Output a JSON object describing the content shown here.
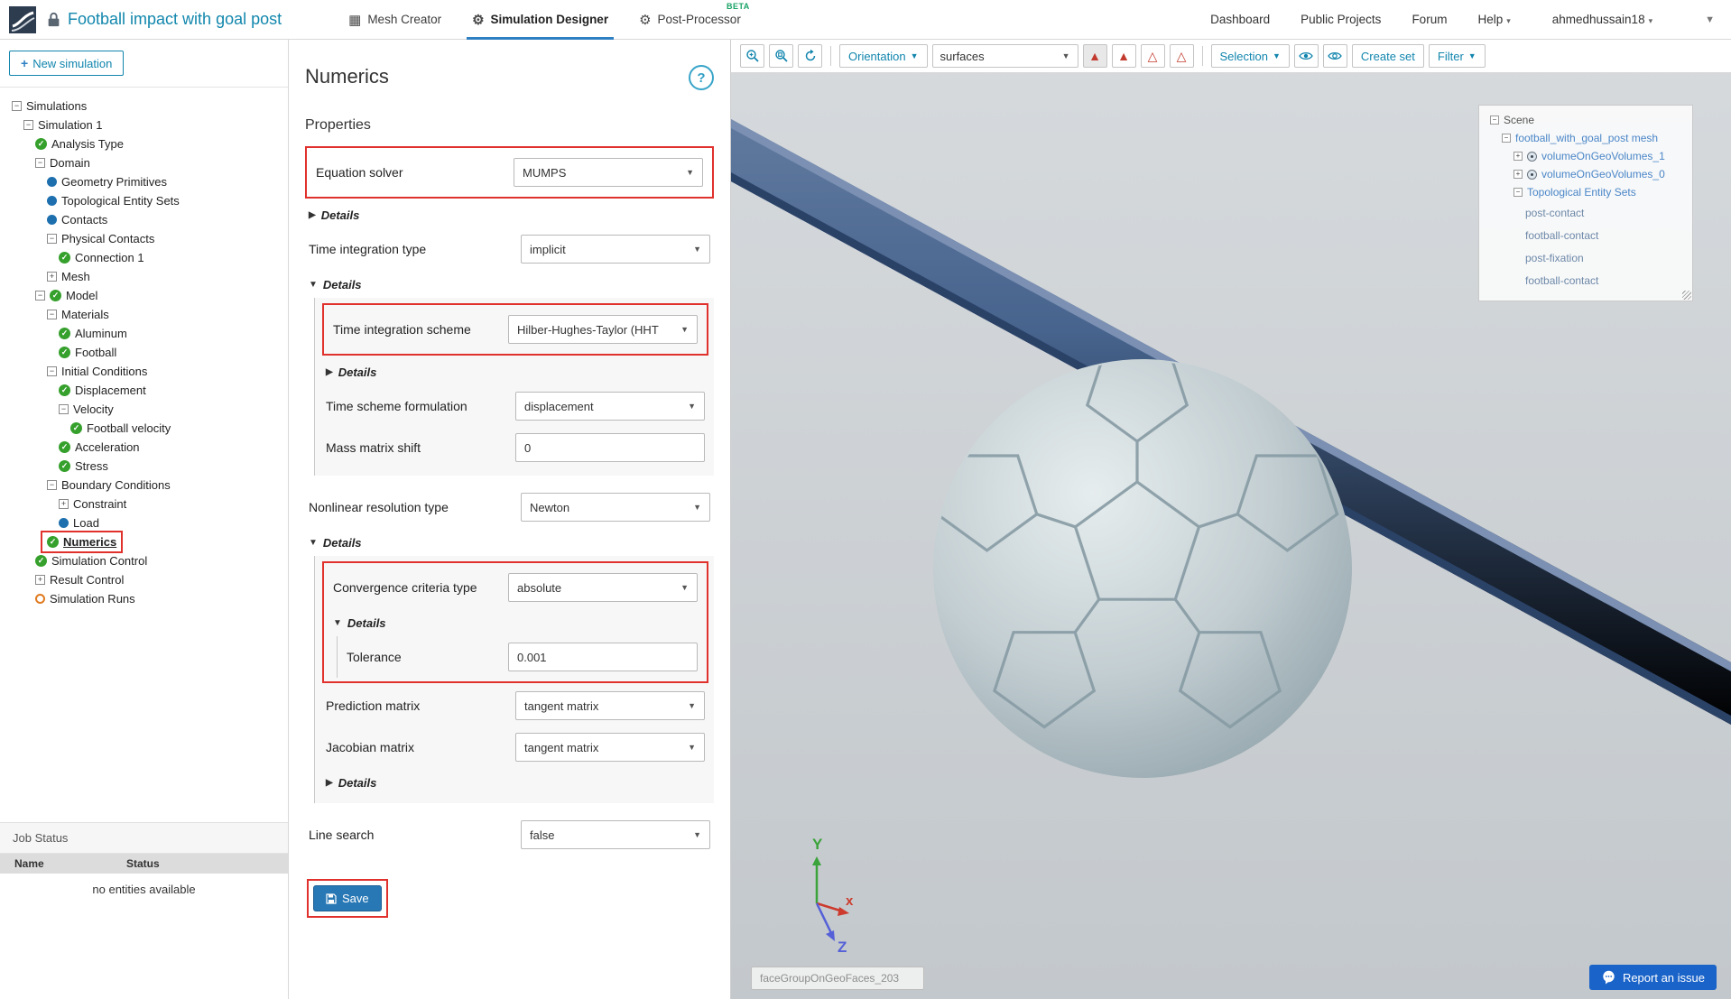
{
  "header": {
    "title": "Football impact with goal post",
    "tabs": [
      {
        "label": "Mesh Creator"
      },
      {
        "label": "Simulation Designer"
      },
      {
        "label": "Post-Processor",
        "badge": "BETA"
      }
    ],
    "nav": {
      "dashboard": "Dashboard",
      "public_projects": "Public Projects",
      "forum": "Forum",
      "help": "Help"
    },
    "username": "ahmedhussain18"
  },
  "sidebar": {
    "new_simulation_label": "New simulation",
    "tree": [
      {
        "label": "Simulations",
        "depth": 0,
        "expand": "minus"
      },
      {
        "label": "Simulation 1",
        "depth": 1,
        "expand": "minus"
      },
      {
        "label": "Analysis Type",
        "depth": 2,
        "type": "check"
      },
      {
        "label": "Domain",
        "depth": 2,
        "expand": "minus"
      },
      {
        "label": "Geometry Primitives",
        "depth": 3,
        "type": "dot"
      },
      {
        "label": "Topological Entity Sets",
        "depth": 3,
        "type": "dot"
      },
      {
        "label": "Contacts",
        "depth": 3,
        "type": "dot"
      },
      {
        "label": "Physical Contacts",
        "depth": 3,
        "expand": "minus"
      },
      {
        "label": "Connection 1",
        "depth": 4,
        "type": "check"
      },
      {
        "label": "Mesh",
        "depth": 3,
        "expand": "plus"
      },
      {
        "label": "Model",
        "depth": 2,
        "expand": "minus",
        "type": "check"
      },
      {
        "label": "Materials",
        "depth": 3,
        "expand": "minus"
      },
      {
        "label": "Aluminum",
        "depth": 4,
        "type": "check"
      },
      {
        "label": "Football",
        "depth": 4,
        "type": "check"
      },
      {
        "label": "Initial Conditions",
        "depth": 3,
        "expand": "minus"
      },
      {
        "label": "Displacement",
        "depth": 4,
        "type": "check"
      },
      {
        "label": "Velocity",
        "depth": 4,
        "expand": "minus"
      },
      {
        "label": "Football velocity",
        "depth": 5,
        "type": "check"
      },
      {
        "label": "Acceleration",
        "depth": 4,
        "type": "check"
      },
      {
        "label": "Stress",
        "depth": 4,
        "type": "check"
      },
      {
        "label": "Boundary Conditions",
        "depth": 3,
        "expand": "minus"
      },
      {
        "label": "Constraint",
        "depth": 4,
        "expand": "plus"
      },
      {
        "label": "Load",
        "depth": 4,
        "type": "dot"
      },
      {
        "label": "Numerics",
        "depth": 3,
        "type": "check",
        "selected": true
      },
      {
        "label": "Simulation Control",
        "depth": 2,
        "type": "check"
      },
      {
        "label": "Result Control",
        "depth": 2,
        "expand": "plus"
      },
      {
        "label": "Simulation Runs",
        "depth": 2,
        "type": "run"
      }
    ],
    "job_status": {
      "title": "Job Status",
      "col_name": "Name",
      "col_status": "Status",
      "empty_message": "no entities available"
    }
  },
  "panel": {
    "title": "Numerics",
    "help_label": "?",
    "subtitle": "Properties",
    "details_label": "Details",
    "fields": {
      "equation_solver": {
        "label": "Equation solver",
        "value": "MUMPS"
      },
      "time_integration_type": {
        "label": "Time integration type",
        "value": "implicit"
      },
      "time_integration_scheme": {
        "label": "Time integration scheme",
        "value": "Hilber-Hughes-Taylor (HHT"
      },
      "time_scheme_formulation": {
        "label": "Time scheme formulation",
        "value": "displacement"
      },
      "mass_matrix_shift": {
        "label": "Mass matrix shift",
        "value": "0"
      },
      "nonlinear_resolution_type": {
        "label": "Nonlinear resolution type",
        "value": "Newton"
      },
      "convergence_criteria_type": {
        "label": "Convergence criteria type",
        "value": "absolute"
      },
      "tolerance": {
        "label": "Tolerance",
        "value": "0.001"
      },
      "prediction_matrix": {
        "label": "Prediction matrix",
        "value": "tangent matrix"
      },
      "jacobian_matrix": {
        "label": "Jacobian matrix",
        "value": "tangent matrix"
      },
      "line_search": {
        "label": "Line search",
        "value": "false"
      }
    },
    "save_label": "Save"
  },
  "viewport": {
    "toolbar": {
      "orientation_label": "Orientation",
      "render_mode_value": "surfaces",
      "selection_label": "Selection",
      "create_set_label": "Create set",
      "filter_label": "Filter"
    },
    "scene_tree": [
      {
        "label": "Scene",
        "depth": 0,
        "expand": "minus",
        "cls": "dark"
      },
      {
        "label": "football_with_goal_post mesh",
        "depth": 1,
        "expand": "minus"
      },
      {
        "label": "volumeOnGeoVolumes_1",
        "depth": 2,
        "expand": "plus",
        "type": "vol"
      },
      {
        "label": "volumeOnGeoVolumes_0",
        "depth": 2,
        "expand": "plus",
        "type": "vol"
      },
      {
        "label": "Topological Entity Sets",
        "depth": 2,
        "expand": "minus"
      },
      {
        "label": "post-contact",
        "depth": 3,
        "cls": "leaf"
      },
      {
        "label": "football-contact",
        "depth": 3,
        "cls": "leaf"
      },
      {
        "label": "post-fixation",
        "depth": 3,
        "cls": "leaf"
      },
      {
        "label": "football-contact",
        "depth": 3,
        "cls": "leaf"
      }
    ],
    "face_label": "faceGroupOnGeoFaces_203",
    "report_issue_label": "Report an issue",
    "axes": {
      "x": "x",
      "y": "Y",
      "z": "Z"
    }
  },
  "colors": {
    "accent_teal": "#1185ad",
    "active_tab_blue": "#2f80c3",
    "highlight_red": "#e0312d",
    "save_blue": "#2878b5",
    "report_blue": "#1a63c8",
    "check_green": "#36a02c",
    "dot_blue": "#1d6fae",
    "run_orange": "#e07a1f",
    "beta_green": "#18a366",
    "goal_post_blue": "#3d5a82",
    "ball_grey": "#c3ced2"
  }
}
